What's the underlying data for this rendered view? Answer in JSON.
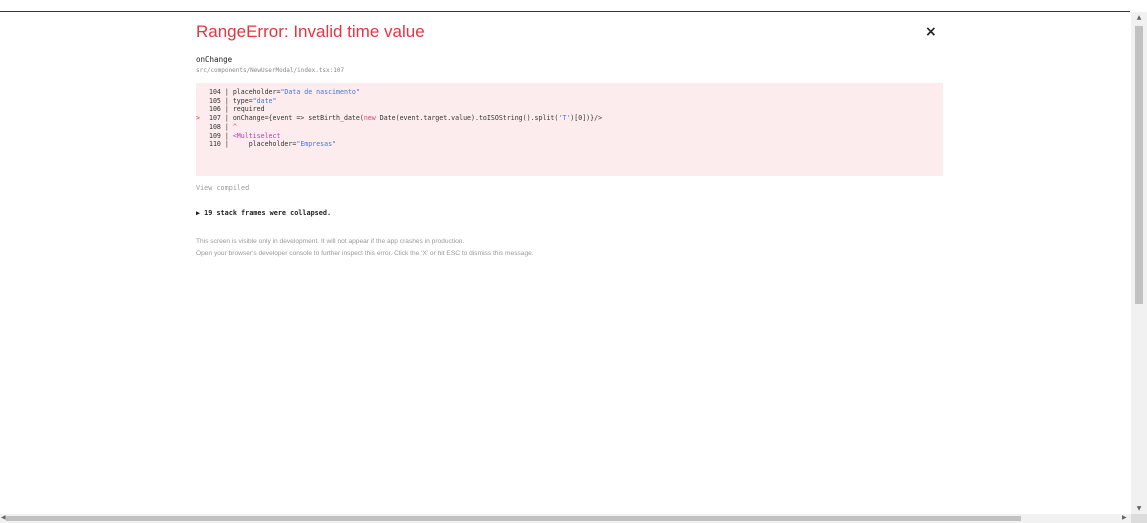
{
  "error": {
    "title": "RangeError: Invalid time value",
    "close_label": "×",
    "function_name": "onChange",
    "source_path": "src/components/NewUserModal/index.tsx:107"
  },
  "code_lines": [
    {
      "marker": "",
      "num": "104",
      "text": "placeholder=\"Data de nascimento\""
    },
    {
      "marker": "",
      "num": "105",
      "text": "type=\"date\""
    },
    {
      "marker": "",
      "num": "106",
      "text": "required"
    },
    {
      "marker": ">",
      "num": "107",
      "text": "onChange={event => setBirth_date(new Date(event.target.value).toISOString().split('T')[0])}/>"
    },
    {
      "marker": "",
      "num": "108",
      "text": "^"
    },
    {
      "marker": "",
      "num": "109",
      "text": "<Multiselect"
    },
    {
      "marker": "",
      "num": "110",
      "text": "    placeholder=\"Empresas\""
    }
  ],
  "view_compiled": "View compiled",
  "stack_frames": "▶ 19 stack frames were collapsed.",
  "footer": {
    "line1": "This screen is visible only in development. It will not appear if the app crashes in production.",
    "line2": "Open your browser's developer console to further inspect this error.  Click the 'X' or hit ESC to dismiss this message."
  },
  "colors": {
    "error_red": "#e23640",
    "code_bg": "#fcecee",
    "string_blue": "#4a78c8",
    "keyword_pink": "#e0457b",
    "tag_purple": "#c438c2"
  }
}
